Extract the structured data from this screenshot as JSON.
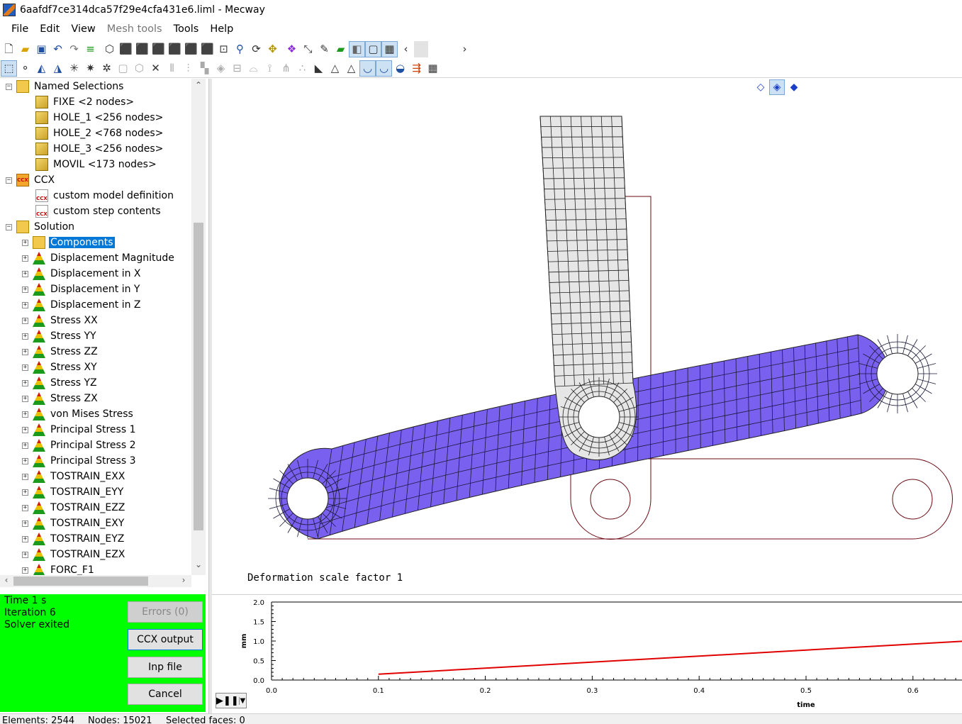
{
  "window": {
    "title": "6aafdf7ce314dca57f29e4cfa431e6.liml - Mecway"
  },
  "menu": [
    {
      "label": "File",
      "enabled": true
    },
    {
      "label": "Edit",
      "enabled": true
    },
    {
      "label": "View",
      "enabled": true
    },
    {
      "label": "Mesh tools",
      "enabled": false
    },
    {
      "label": "Tools",
      "enabled": true
    },
    {
      "label": "Help",
      "enabled": true
    }
  ],
  "toolbar1_icons": [
    "new-file-icon",
    "open-folder-icon",
    "save-icon",
    "undo-icon",
    "redo-icon",
    "equals-icon",
    "view-iso-icon",
    "view-front-icon",
    "view-back-icon",
    "view-left-icon",
    "view-right-icon",
    "view-top-icon",
    "view-bottom-icon",
    "zoom-fit-icon",
    "zoom-icon",
    "rotate-icon",
    "pan-icon",
    "render-icon",
    "transform-icon",
    "measure-icon",
    "surface-icon",
    "shading-icon",
    "wireframe-icon",
    "mesh-icon",
    "scroll-left-icon",
    "scroll-right-icon"
  ],
  "toolbar2_icons": [
    "select-box-icon",
    "select-node-icon",
    "select-element-icon",
    "select-face-icon",
    "select-edge-icon",
    "explode-icon",
    "deselect-icon",
    "hide-icon",
    "show-icon",
    "delete-icon",
    "extrude-icon",
    "refine-icon",
    "join-icon",
    "split-icon",
    "mirror-icon",
    "merge-icon",
    "tree-icon",
    "dots-icon",
    "triangle-fill-icon",
    "triangle-icon",
    "triangle-outline-icon",
    "deform-icon",
    "deform-scale-icon",
    "animate-icon",
    "color-bar-icon",
    "arrows-icon",
    "table-icon"
  ],
  "tree": {
    "named_selections": {
      "label": "Named Selections",
      "items": [
        "FIXE <2 nodes>",
        "HOLE_1 <256 nodes>",
        "HOLE_2 <768 nodes>",
        "HOLE_3 <256 nodes>",
        "MOVIL <173 nodes>"
      ]
    },
    "ccx": {
      "label": "CCX",
      "items": [
        "custom model definition",
        "custom step contents"
      ]
    },
    "solution": {
      "label": "Solution",
      "selected": "Components",
      "items": [
        "Components",
        "Displacement Magnitude",
        "Displacement in X",
        "Displacement in Y",
        "Displacement in Z",
        "Stress XX",
        "Stress YY",
        "Stress ZZ",
        "Stress XY",
        "Stress YZ",
        "Stress ZX",
        "von Mises Stress",
        "Principal Stress 1",
        "Principal Stress 2",
        "Principal Stress 3",
        "TOSTRAIN_EXX",
        "TOSTRAIN_EYY",
        "TOSTRAIN_EZZ",
        "TOSTRAIN_EXY",
        "TOSTRAIN_EYZ",
        "TOSTRAIN_EZX",
        "FORC_F1"
      ]
    }
  },
  "viewport": {
    "label": "Deformation scale factor 1",
    "view_cubes": [
      "view-cube-wire-icon",
      "view-cube-shaded-icon",
      "view-cube-solid-icon"
    ],
    "colors": {
      "purple_part": "#7a60ee",
      "grey_part": "#e6e6e6",
      "outline": "#6b0a12"
    }
  },
  "status": {
    "time": "Time  1  s",
    "iteration": "Iteration  6",
    "solver": "Solver exited",
    "buttons": {
      "errors": "Errors (0)",
      "ccx_output": "CCX output",
      "inp_file": "Inp file",
      "cancel": "Cancel"
    }
  },
  "graph": {
    "play_label": "▶❚❚",
    "dropdown_icon": "chevron-down-icon"
  },
  "chart_data": {
    "type": "line",
    "title": "",
    "xlabel": "time",
    "ylabel": "mm",
    "xlim": [
      0,
      0.65
    ],
    "ylim": [
      0,
      2.0
    ],
    "x_ticks": [
      "0.0",
      "0.1",
      "0.2",
      "0.3",
      "0.4",
      "0.5",
      "0.6"
    ],
    "y_ticks": [
      "0.0",
      "0.5",
      "1.0",
      "1.5",
      "2.0"
    ],
    "series": [
      {
        "color": "#e00000",
        "x": [
          0.1,
          0.65
        ],
        "y": [
          0.15,
          1.0
        ]
      }
    ]
  },
  "statusbar": {
    "elements": "Elements: 2544",
    "nodes": "Nodes: 15021",
    "selected": "Selected faces: 0"
  }
}
